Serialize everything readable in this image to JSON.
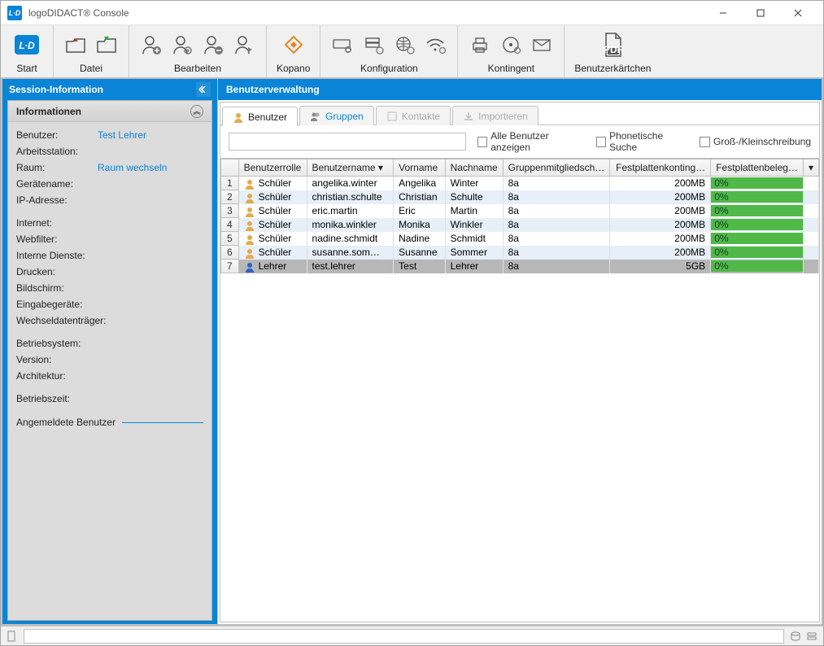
{
  "window": {
    "title": "logoDIDACT® Console",
    "app_badge": "L∙D"
  },
  "toolbar": {
    "start": "Start",
    "datei": "Datei",
    "bearbeiten": "Bearbeiten",
    "kopano": "Kopano",
    "konfiguration": "Konfiguration",
    "kontingent": "Kontingent",
    "benutzerkaertchen": "Benutzerkärtchen"
  },
  "sidebar": {
    "session_header": "Session-Information",
    "info_header": "Informationen",
    "rows": {
      "benutzer": {
        "k": "Benutzer:",
        "v": "Test Lehrer"
      },
      "arbeitsstation": {
        "k": "Arbeitsstation:",
        "v": ""
      },
      "raum": {
        "k": "Raum:",
        "v": "Raum wechseln"
      },
      "geraetename": {
        "k": "Gerätename:",
        "v": ""
      },
      "ip": {
        "k": "IP-Adresse:",
        "v": ""
      },
      "internet": {
        "k": "Internet:",
        "v": ""
      },
      "webfilter": {
        "k": "Webfilter:",
        "v": ""
      },
      "interne": {
        "k": "Interne Dienste:",
        "v": ""
      },
      "drucken": {
        "k": "Drucken:",
        "v": ""
      },
      "bildschirm": {
        "k": "Bildschirm:",
        "v": ""
      },
      "eingabe": {
        "k": "Eingabegeräte:",
        "v": ""
      },
      "wechsel": {
        "k": "Wechseldatenträger:",
        "v": ""
      },
      "betriebssystem": {
        "k": "Betriebsystem:",
        "v": ""
      },
      "version": {
        "k": "Version:",
        "v": ""
      },
      "architektur": {
        "k": "Architektur:",
        "v": ""
      },
      "betriebszeit": {
        "k": "Betriebszeit:",
        "v": ""
      }
    },
    "angemeldete": "Angemeldete Benutzer"
  },
  "content": {
    "header": "Benutzerverwaltung",
    "tabs": {
      "benutzer": "Benutzer",
      "gruppen": "Gruppen",
      "kontakte": "Kontakte",
      "importieren": "Importieren"
    },
    "filters": {
      "alle": "Alle Benutzer anzeigen",
      "phonetic": "Phonetische Suche",
      "case": "Groß-/Kleinschreibung"
    },
    "columns": {
      "rolle": "Benutzerrolle",
      "name": "Benutzername ▾",
      "vorname": "Vorname",
      "nachname": "Nachname",
      "gruppen": "Gruppenmitgliedsch…",
      "quota": "Festplattenkonting…",
      "usage": "Festplattenbeleg…"
    },
    "rows": [
      {
        "n": "1",
        "rolle": "Schüler",
        "name": "angelika.winter",
        "vor": "Angelika",
        "nach": "Winter",
        "grp": "8a",
        "quota": "200MB",
        "use": "0%",
        "teacher": false
      },
      {
        "n": "2",
        "rolle": "Schüler",
        "name": "christian.schulte",
        "vor": "Christian",
        "nach": "Schulte",
        "grp": "8a",
        "quota": "200MB",
        "use": "0%",
        "teacher": false
      },
      {
        "n": "3",
        "rolle": "Schüler",
        "name": "eric.martin",
        "vor": "Eric",
        "nach": "Martin",
        "grp": "8a",
        "quota": "200MB",
        "use": "0%",
        "teacher": false
      },
      {
        "n": "4",
        "rolle": "Schüler",
        "name": "monika.winkler",
        "vor": "Monika",
        "nach": "Winkler",
        "grp": "8a",
        "quota": "200MB",
        "use": "0%",
        "teacher": false
      },
      {
        "n": "5",
        "rolle": "Schüler",
        "name": "nadine.schmidt",
        "vor": "Nadine",
        "nach": "Schmidt",
        "grp": "8a",
        "quota": "200MB",
        "use": "0%",
        "teacher": false
      },
      {
        "n": "6",
        "rolle": "Schüler",
        "name": "susanne.som…",
        "vor": "Susanne",
        "nach": "Sommer",
        "grp": "8a",
        "quota": "200MB",
        "use": "0%",
        "teacher": false
      },
      {
        "n": "7",
        "rolle": "Lehrer",
        "name": "test.lehrer",
        "vor": "Test",
        "nach": "Lehrer",
        "grp": "8a",
        "quota": "5GB",
        "use": "0%",
        "teacher": true,
        "selected": true
      }
    ]
  }
}
